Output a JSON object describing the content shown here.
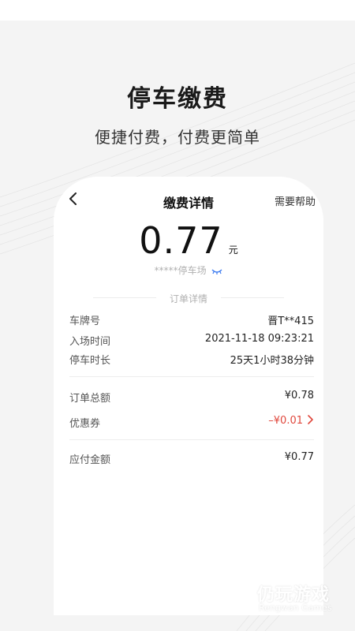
{
  "hero": {
    "title": "停车缴费",
    "subtitle": "便捷付费，付费更简单"
  },
  "nav": {
    "back_icon": "chevron-left-icon",
    "title": "缴费详情",
    "help_label": "需要帮助"
  },
  "amount": {
    "value": "0.77",
    "unit": "元"
  },
  "parking_lot": {
    "name": "*****停车场",
    "icon": "eye-closed-icon"
  },
  "section": {
    "label": "订单详情"
  },
  "details": [
    {
      "key": "车牌号",
      "value": "晋T**415"
    },
    {
      "key": "入场时间",
      "value": "2021-11-18 09:23:21"
    },
    {
      "key": "停车时长",
      "value": "25天1小时38分钟"
    }
  ],
  "order": {
    "total_label": "订单总额",
    "total_value": "¥0.78",
    "coupon_label": "优惠券",
    "coupon_value": "–¥0.01",
    "coupon_chevron": "chevron-right-icon"
  },
  "payable": {
    "label": "应付金额",
    "value": "¥0.77"
  },
  "watermark": {
    "name": "仍玩游戏",
    "sub": "Rengwan Games"
  },
  "colors": {
    "accent_red": "#e0473c",
    "eye_blue": "#3d7cf0"
  }
}
